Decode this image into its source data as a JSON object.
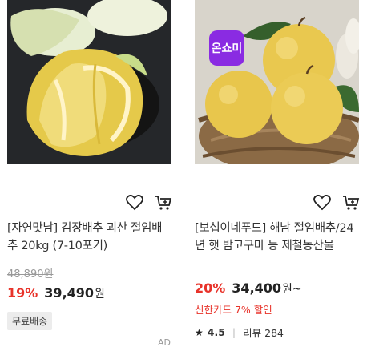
{
  "products": [
    {
      "title": "[자연맛남] 김장배추 괴산 절임배추 20kg (7-10포기)",
      "original_price": "48,890원",
      "discount": "19%",
      "price": "39,490",
      "currency": "원",
      "shipping_badge": "무료배송",
      "icons": [
        "heart-icon",
        "cart-icon"
      ]
    },
    {
      "title": "[보섭이네푸드] 해남 절임배추/24년 햇 밤고구마 등 제철농산물",
      "discount": "20%",
      "price": "34,400",
      "currency": "원~",
      "card_promo": "신한카드 7% 할인",
      "rating": "4.5",
      "reviews": "리뷰 284",
      "badge": "온쇼미",
      "icons": [
        "heart-icon",
        "cart-icon"
      ]
    }
  ],
  "ad_label": "AD",
  "colors": {
    "discount": "#e8332a",
    "badge": "#8a2be2"
  }
}
